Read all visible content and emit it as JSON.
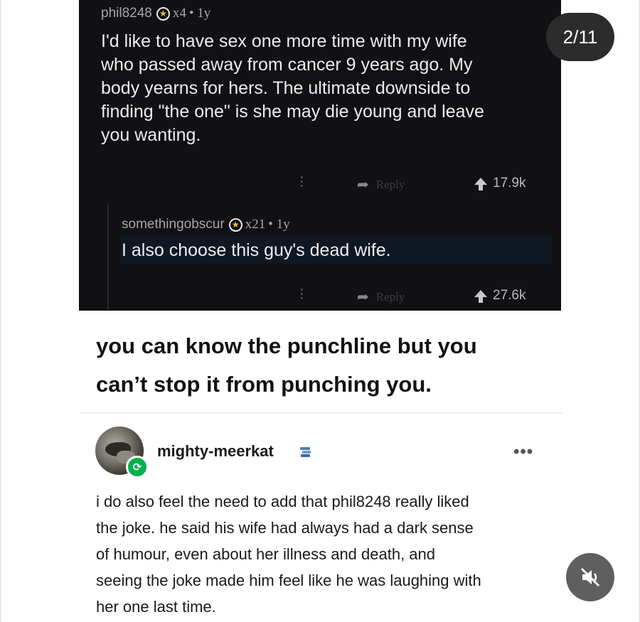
{
  "overlay": {
    "page_indicator": "2/11",
    "mute_icon": "speaker-muted-icon"
  },
  "reddit_screenshot": {
    "comment1": {
      "username": "phil8248",
      "award_count": "x4",
      "age": "• 1y",
      "body_lines": [
        "I'd like to have sex one more time with my wife",
        "who passed away from cancer 9 years ago. My",
        "body yearns for hers. The ultimate downside to",
        "finding \"the one\" is she may die young and leave",
        "you wanting."
      ],
      "reply_label": "Reply",
      "votes": "17.9k"
    },
    "comment2": {
      "username": "somethingobscur",
      "award_count": "x21",
      "age": "• 1y",
      "body": "I also choose this guy's dead wife.",
      "reply_label": "Reply",
      "votes": "27.6k"
    }
  },
  "caption_lines": [
    "you can know the punchline but you",
    "can’t stop it from punching you."
  ],
  "reply_post": {
    "username": "mighty-meerkat",
    "more_label": "•••",
    "text_lines": [
      "i do also feel the need to add that phil8248 really liked",
      "the joke. he said his wife had always had a dark sense",
      "of humour, even about her illness and death, and",
      "seeing the joke made him feel like he was laughing with",
      "her one last time."
    ]
  },
  "colors": {
    "dark_bg": "#111113",
    "reblog_green": "#00b04c",
    "award_gold": "#f4c04a"
  }
}
